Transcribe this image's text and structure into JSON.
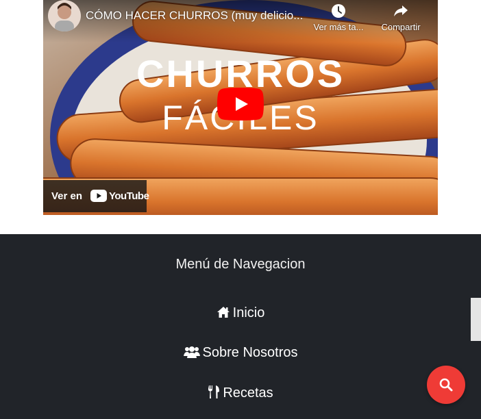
{
  "video": {
    "title": "CÓMO HACER CHURROS (muy delicio...",
    "watch_later_label": "Ver más ta...",
    "share_label": "Compartir",
    "watch_on_label": "Ver en",
    "youtube_wordmark": "YouTube",
    "thumbnail_heading": "CHURROS",
    "thumbnail_subheading": "FÁCILES"
  },
  "footer": {
    "title": "Menú de Navegacion",
    "nav_items": [
      {
        "label": "Inicio",
        "icon": "home-icon"
      },
      {
        "label": "Sobre Nosotros",
        "icon": "users-icon"
      },
      {
        "label": "Recetas",
        "icon": "utensils-icon"
      }
    ]
  },
  "search_fab": {
    "icon": "search-icon"
  },
  "colors": {
    "footer_bg": "#212429",
    "fab_red": "#ef3b36",
    "youtube_red": "#ff0000"
  }
}
